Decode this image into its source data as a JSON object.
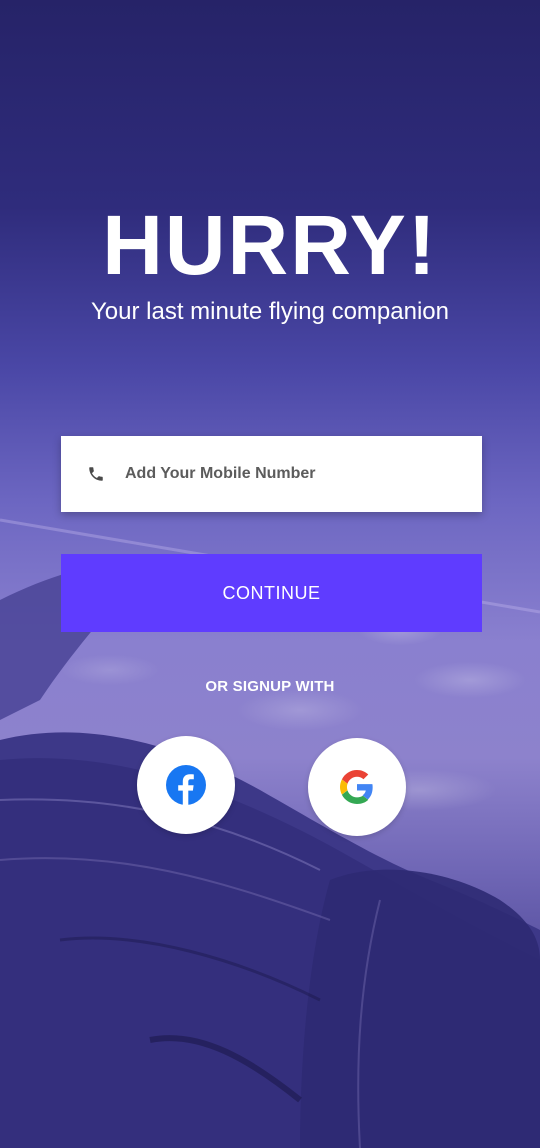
{
  "hero": {
    "title": "HURRY!",
    "subtitle": "Your last minute flying companion"
  },
  "form": {
    "phone_placeholder": "Add Your Mobile Number",
    "phone_value": "",
    "continue_label": "CONTINUE"
  },
  "social": {
    "label": "OR SIGNUP WITH",
    "providers": [
      "facebook",
      "google"
    ]
  },
  "colors": {
    "background_top": "#262368",
    "button": "#5f3cff",
    "facebook": "#1877f2",
    "text": "#ffffff"
  },
  "icons": {
    "phone": "phone-icon",
    "facebook": "facebook-icon",
    "google": "google-icon"
  }
}
